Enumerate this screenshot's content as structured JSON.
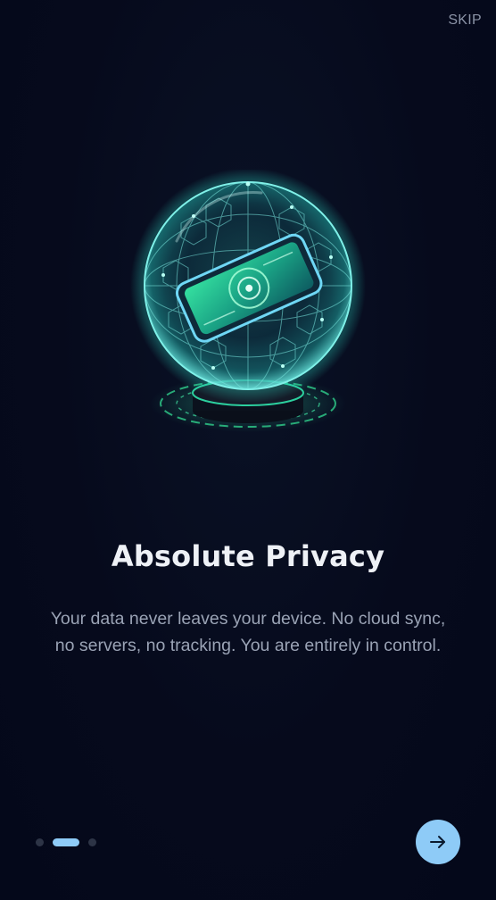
{
  "header": {
    "skip_label": "SKIP"
  },
  "illustration": {
    "icon": "privacy-sphere-phone-illustration"
  },
  "onboarding": {
    "title": "Absolute Privacy",
    "description": "Your data never leaves your device. No cloud sync, no servers, no tracking. You are entirely in control."
  },
  "pagination": {
    "total": 3,
    "current": 2
  },
  "navigation": {
    "next_icon": "arrow-right-icon"
  },
  "colors": {
    "background": "#05091a",
    "accent": "#8ecbf7",
    "title": "#eef1f6",
    "body_text": "#9aa3b5",
    "skip_text": "#8b93a6",
    "glow_green": "#35e0a0",
    "glow_cyan": "#5fd8f0"
  }
}
